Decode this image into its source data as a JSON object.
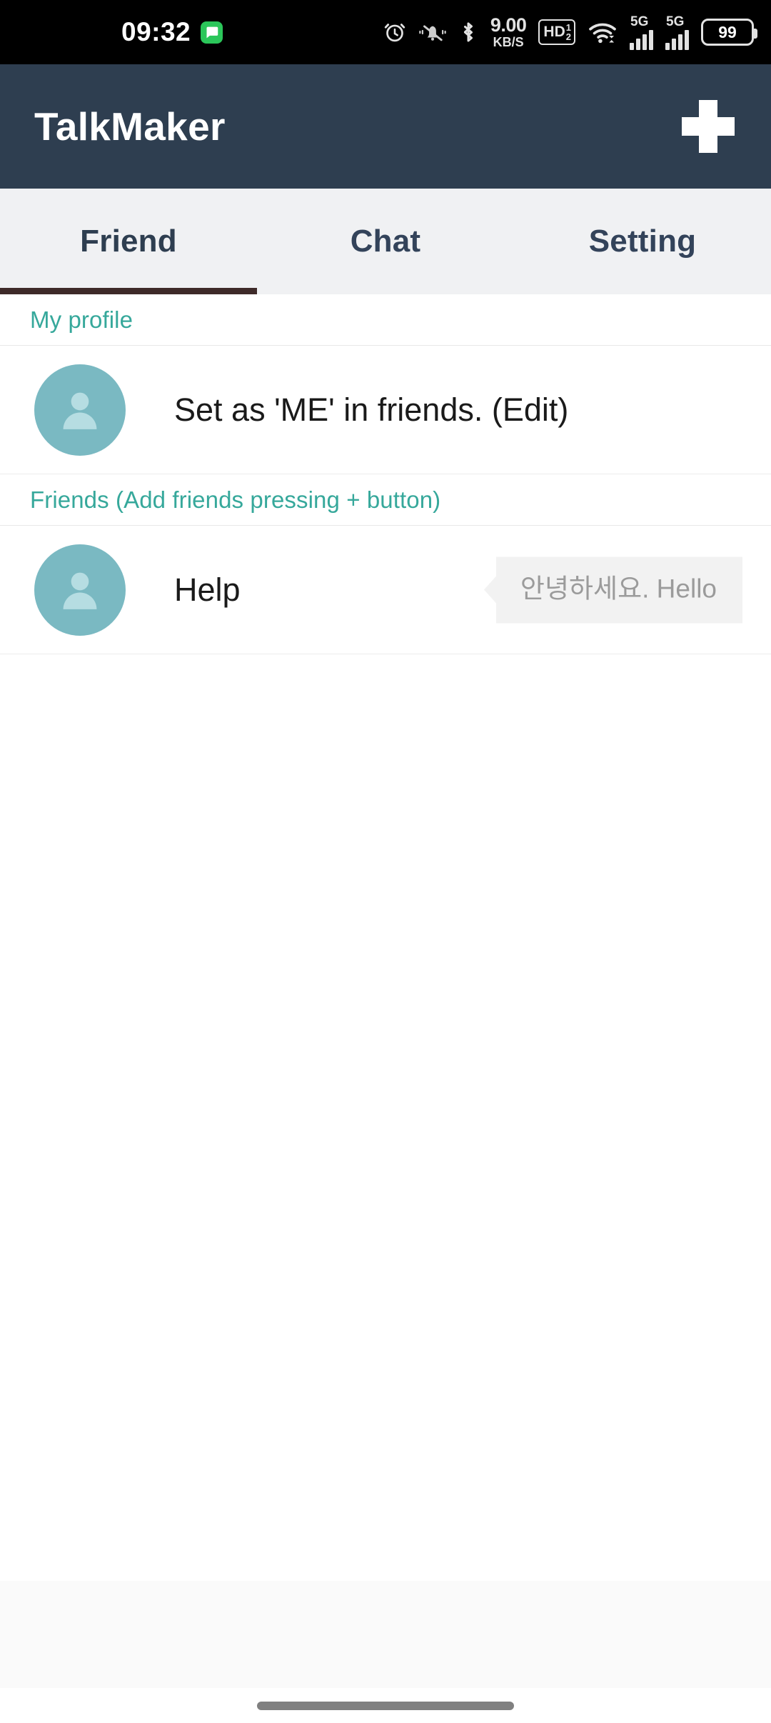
{
  "status_bar": {
    "time": "09:32",
    "message_icon": "message-bubble-icon",
    "icons": [
      {
        "name": "alarm-clock-icon"
      },
      {
        "name": "mute-bell-icon"
      },
      {
        "name": "bluetooth-icon"
      },
      {
        "name": "network-speed-indicator"
      },
      {
        "name": "hd-voice-icon"
      },
      {
        "name": "wifi-icon"
      },
      {
        "name": "signal-sim1-icon"
      },
      {
        "name": "signal-sim2-icon"
      },
      {
        "name": "battery-icon"
      }
    ],
    "net_speed_value": "9.00",
    "net_speed_unit": "KB/S",
    "hd_label": "HD",
    "hd_sup": "1",
    "hd_sub": "2",
    "sim1_network": "5G",
    "sim2_network": "5G",
    "battery_percent": "99"
  },
  "app_bar": {
    "title": "TalkMaker",
    "add_button_label": "+",
    "background_color": "#2e3e50"
  },
  "tabs": {
    "active_index": 0,
    "indicator_color": "#3e2a29",
    "items": [
      {
        "label": "Friend"
      },
      {
        "label": "Chat"
      },
      {
        "label": "Setting"
      }
    ]
  },
  "list": {
    "accent_color": "#36a89b",
    "avatar_color": "#7ab9c2",
    "sections": [
      {
        "header": "My profile",
        "rows": [
          {
            "name": "Set as 'ME' in friends. (Edit)",
            "avatar": "person-placeholder-avatar",
            "status_message": null
          }
        ]
      },
      {
        "header": "Friends (Add friends pressing + button)",
        "rows": [
          {
            "name": "Help",
            "avatar": "person-placeholder-avatar",
            "status_message": "안녕하세요. Hello"
          }
        ]
      }
    ]
  },
  "bottom": {
    "nav_pill": "home-gesture-pill"
  }
}
